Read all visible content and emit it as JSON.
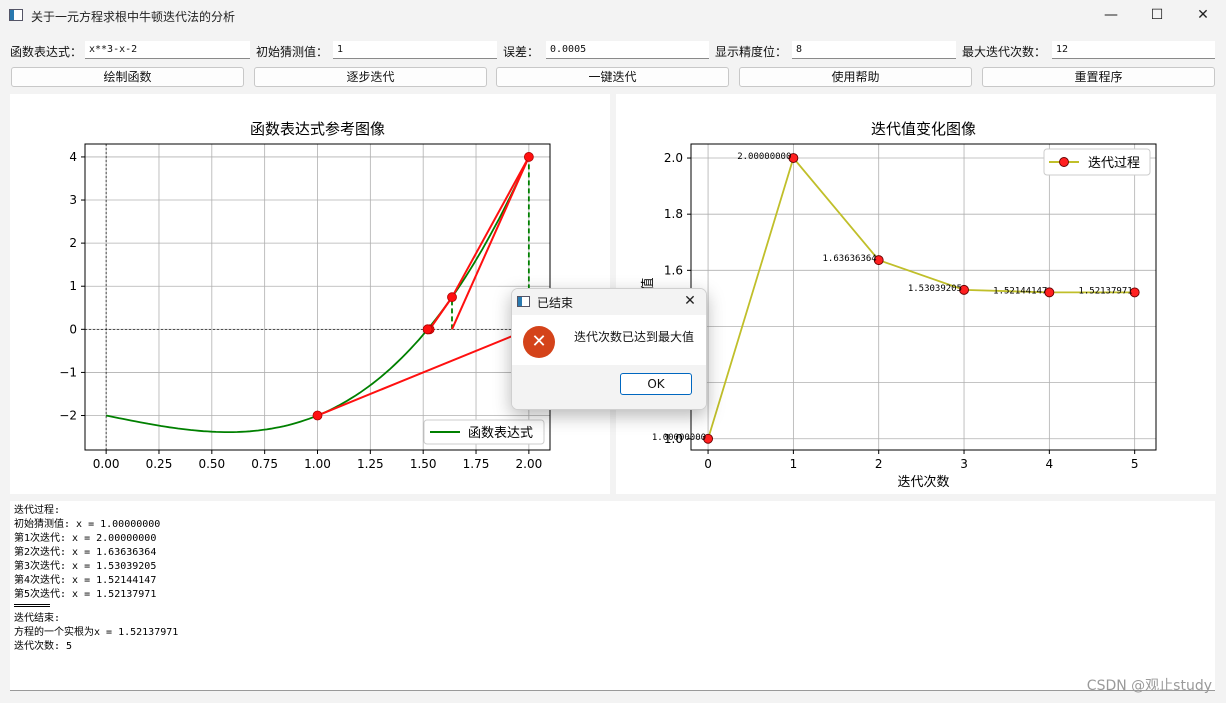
{
  "window": {
    "title": "关于一元方程求根中牛顿迭代法的分析",
    "minimize": "—",
    "maximize": "☐",
    "close": "✕"
  },
  "params": {
    "expr_label": "函数表达式：",
    "expr_value": "x**3-x-2",
    "guess_label": "初始猜测值：",
    "guess_value": "1",
    "error_label": "误差：",
    "error_value": "0.0005",
    "precision_label": "显示精度位：",
    "precision_value": "8",
    "maxiter_label": "最大迭代次数：",
    "maxiter_value": "12"
  },
  "buttons": {
    "plot": "绘制函数",
    "step": "逐步迭代",
    "run": "一键迭代",
    "help": "使用帮助",
    "reset": "重置程序"
  },
  "chart_data": [
    {
      "type": "line",
      "title": "函数表达式参考图像",
      "function": "x**3-x-2",
      "xlim": [
        -0.1,
        2.1
      ],
      "ylim": [
        -2.8,
        4.3
      ],
      "xticks": [
        "0.00",
        "0.25",
        "0.50",
        "0.75",
        "1.00",
        "1.25",
        "1.50",
        "1.75",
        "2.00"
      ],
      "yticks": [
        "−2",
        "−1",
        "0",
        "1",
        "2",
        "3",
        "4"
      ],
      "grid": true,
      "legend": "函数表达式",
      "legend_position": "lower-right",
      "curve_color": "#008000",
      "newton_color": "#ff1010",
      "guide_color": "#008000",
      "iterates": [
        {
          "x": 1.0,
          "y": -2.0
        },
        {
          "x": 2.0,
          "y": 4.0
        },
        {
          "x": 1.63636364,
          "y": 0.74530428
        },
        {
          "x": 1.53030205,
          "y": 0.0
        },
        {
          "x": 1.52144147,
          "y": 0.0
        },
        {
          "x": 1.52137971,
          "y": 0.0
        }
      ]
    },
    {
      "type": "line",
      "title": "迭代值变化图像",
      "xlabel": "迭代次数",
      "ylabel": "迭代值",
      "xlim": [
        -0.2,
        5.25
      ],
      "ylim": [
        0.96,
        2.05
      ],
      "xticks": [
        "0",
        "1",
        "2",
        "3",
        "4",
        "5"
      ],
      "yticks": [
        "1.0",
        "1.2",
        "1.4",
        "1.6",
        "1.8",
        "2.0"
      ],
      "grid": true,
      "legend_position": "top-right",
      "line_color": "#c0bf2a",
      "marker_color": "#ff2020",
      "series": [
        {
          "name": "迭代过程",
          "x": [
            0,
            1,
            2,
            3,
            4,
            5
          ],
          "values": [
            1.0,
            2.0,
            1.63636364,
            1.53039205,
            1.52144147,
            1.52137971
          ],
          "labels": [
            "1.00000000",
            "2.00000000",
            "1.63636364",
            "1.53039205",
            "1.52144147",
            "1.52137971"
          ]
        }
      ]
    }
  ],
  "log": {
    "lines": [
      "迭代过程:",
      "初始猜测值: x = 1.00000000",
      "第1次迭代: x = 2.00000000",
      "第2次迭代: x = 1.63636364",
      "第3次迭代: x = 1.53039205",
      "第4次迭代: x = 1.52144147",
      "第5次迭代: x = 1.52137971"
    ],
    "tail": [
      "迭代结束:",
      "方程的一个实根为x = 1.52137971",
      "迭代次数: 5"
    ]
  },
  "dialog": {
    "title": "已结束",
    "message": "迭代次数已达到最大值",
    "ok": "OK",
    "close": "✕",
    "icon": "error-icon"
  },
  "watermark": "CSDN @观止study"
}
